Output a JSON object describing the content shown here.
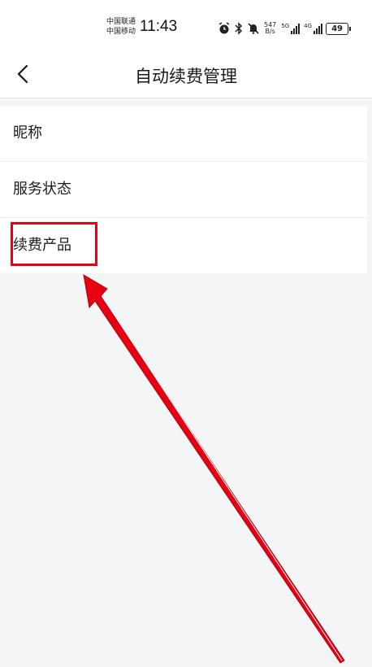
{
  "status_bar": {
    "carrier_1": "中国联通",
    "carrier_2": "中国移动",
    "time": "11:43",
    "net_speed_value": "547",
    "net_speed_unit": "B/s",
    "signal_1_label": "5G",
    "signal_2_label": "4G",
    "battery": "49",
    "icons": [
      "alarm-icon",
      "bluetooth-icon",
      "mute-icon"
    ]
  },
  "navbar": {
    "title": "自动续费管理",
    "back_icon": "chevron-left-icon"
  },
  "list": {
    "items": [
      {
        "label": "昵称"
      },
      {
        "label": "服务状态"
      },
      {
        "label": "续费产品"
      }
    ]
  },
  "annotation": {
    "highlight_color": "#e60012",
    "arrow_color": "#e60012"
  }
}
